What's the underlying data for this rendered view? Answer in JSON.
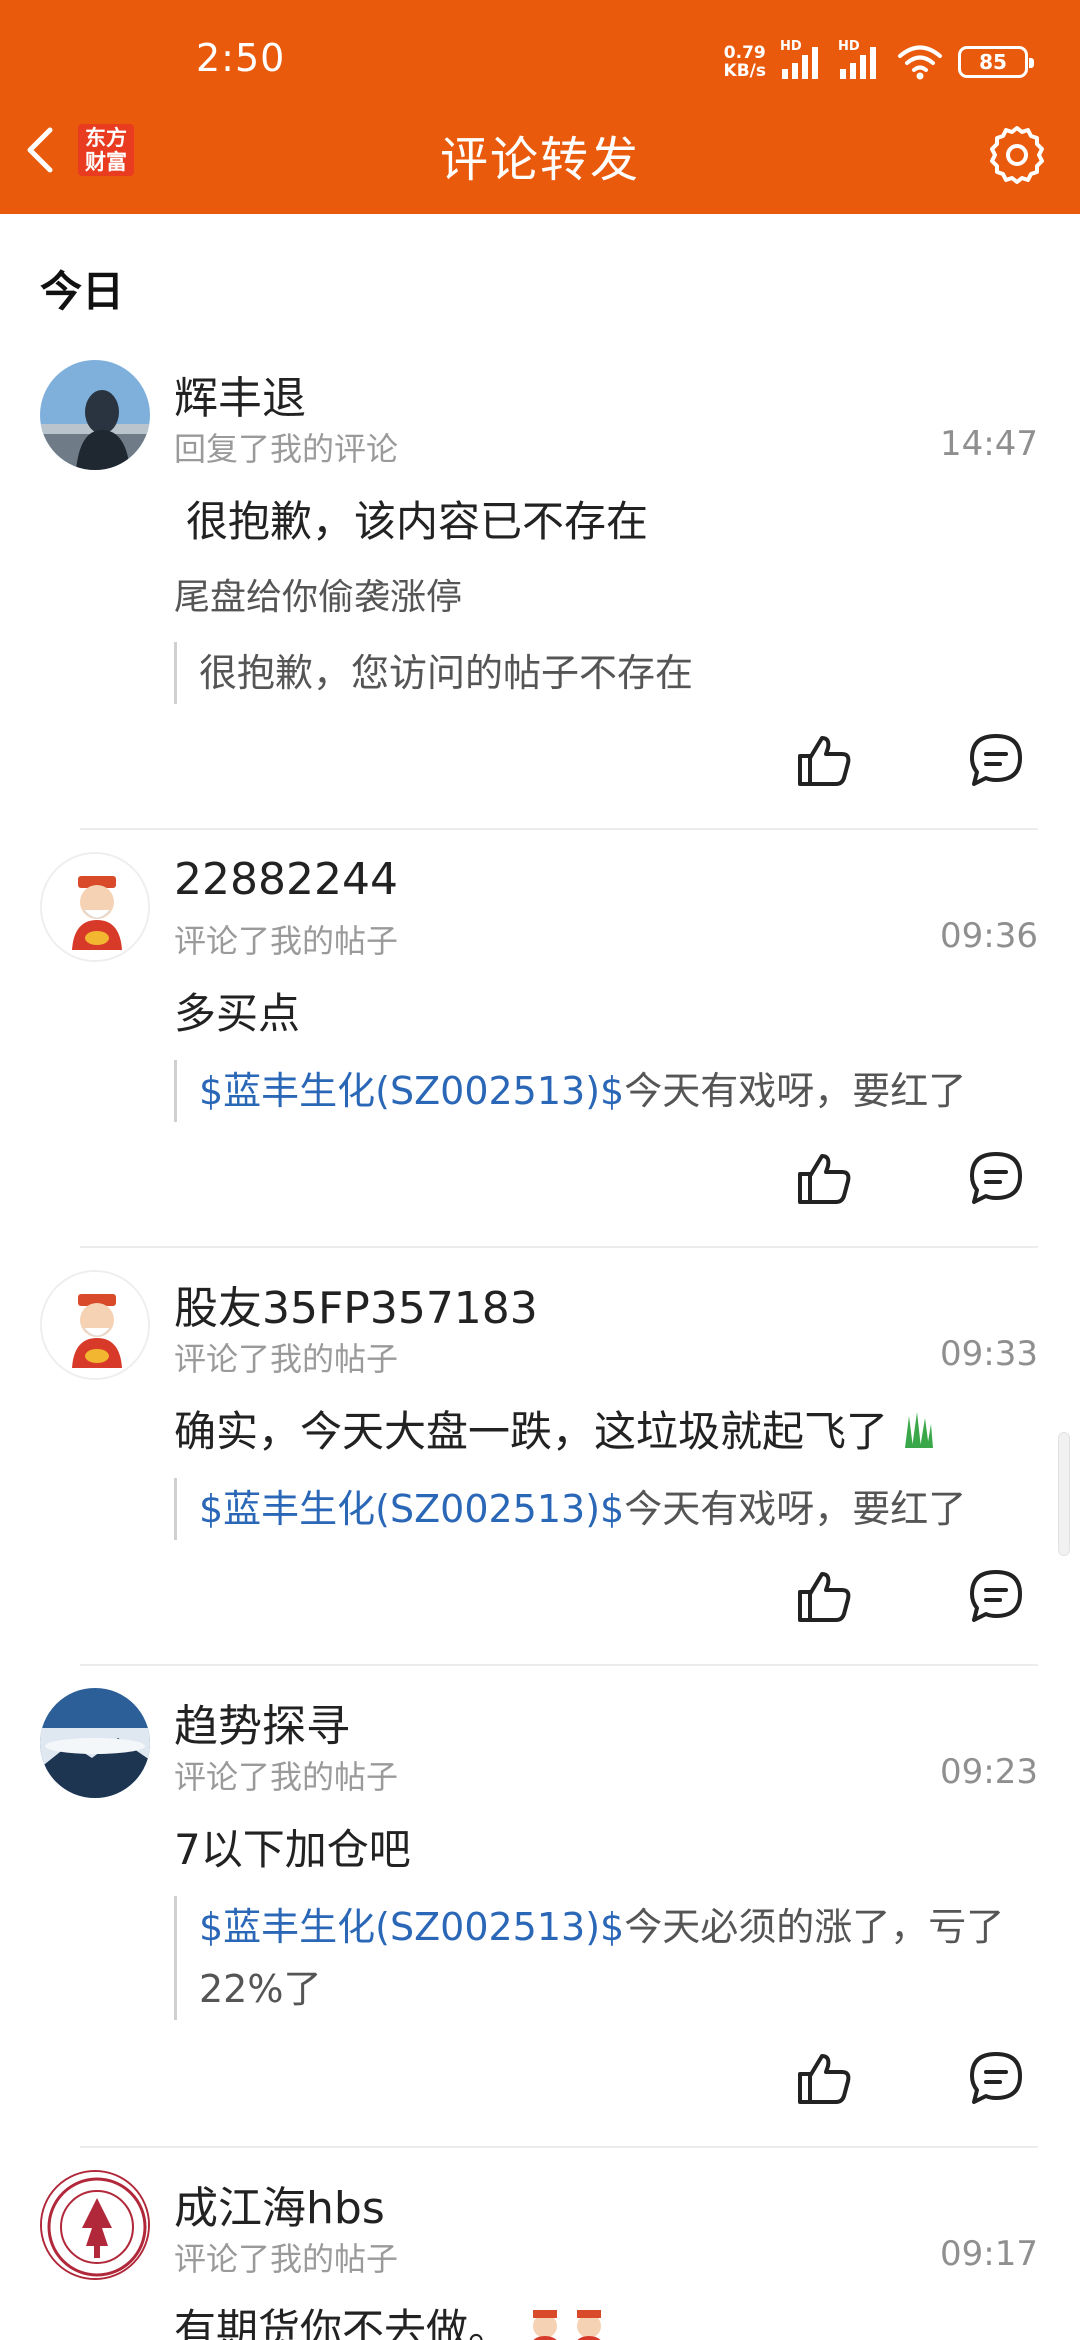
{
  "status_bar": {
    "time": "2:50",
    "net_speed_value": "0.79",
    "net_speed_unit": "KB/s",
    "sim1_label": "HD",
    "sim2_label": "HD",
    "battery": "85"
  },
  "header": {
    "logo_line1": "东方",
    "logo_line2": "财富",
    "title": "评论转发",
    "bg_color": "#ea5a0c"
  },
  "section_label": "今日",
  "items": [
    {
      "username": "辉丰退",
      "action": "回复了我的评论",
      "time": "14:47",
      "deleted_notice": "很抱歉，该内容已不存在",
      "content": "尾盘给你偷袭涨停",
      "quote_text": "很抱歉，您访问的帖子不存在"
    },
    {
      "username": "22882244",
      "action": "评论了我的帖子",
      "time": "09:36",
      "content": "多买点",
      "quote_stock": "$蓝丰生化(SZ002513)$",
      "quote_text": "今天有戏呀，要红了"
    },
    {
      "username": "股友35FP357183",
      "action": "评论了我的帖子",
      "time": "09:33",
      "content": "确实，今天大盘一跌，这垃圾就起飞了",
      "quote_stock": "$蓝丰生化(SZ002513)$",
      "quote_text": "今天有戏呀，要红了"
    },
    {
      "username": "趋势探寻",
      "action": "评论了我的帖子",
      "time": "09:23",
      "content": "7以下加仓吧",
      "quote_stock": "$蓝丰生化(SZ002513)$",
      "quote_text": "今天必须的涨了，亏了22%了"
    },
    {
      "username": "成江海hbs",
      "action": "评论了我的帖子",
      "time": "09:17",
      "content": "有期货你不去做。"
    }
  ],
  "colors": {
    "accent": "#ea5a0c",
    "stock_link": "#2b67b7"
  },
  "icons": [
    "back-arrow-icon",
    "gear-icon",
    "thumbs-up-icon",
    "comment-icon",
    "wifi-icon",
    "signal-icon",
    "battery-icon"
  ]
}
